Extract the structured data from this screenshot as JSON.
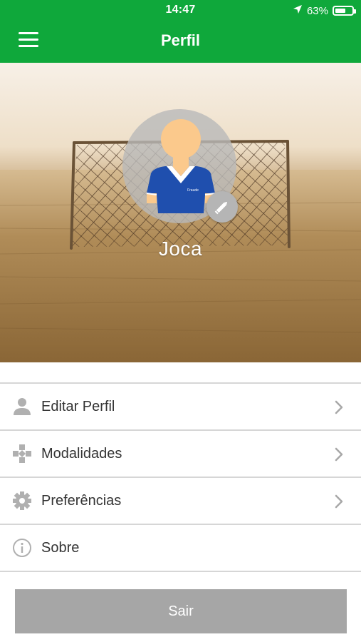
{
  "status_bar": {
    "time": "14:47",
    "battery_text": "63%",
    "battery_level": 0.63,
    "icons": [
      "location-arrow-icon",
      "battery-icon"
    ]
  },
  "app_bar": {
    "title": "Perfil",
    "menu_icon": "hamburger-menu-icon"
  },
  "profile": {
    "name": "Joca",
    "avatar_icon": "player-avatar-icon",
    "edit_icon": "pencil-icon",
    "jersey_text": "Fraude"
  },
  "menu": {
    "items": [
      {
        "label": "Editar Perfil",
        "icon": "user-icon",
        "has_chevron": true
      },
      {
        "label": "Modalidades",
        "icon": "gamepad-icon",
        "has_chevron": true
      },
      {
        "label": "Preferências",
        "icon": "gear-icon",
        "has_chevron": true
      },
      {
        "label": "Sobre",
        "icon": "info-icon",
        "has_chevron": false
      }
    ]
  },
  "logout": {
    "label": "Sair"
  },
  "colors": {
    "primary_green": "#0fa83b",
    "logout_gray": "#a6a6a6",
    "icon_gray": "#b0b0b0",
    "divider": "#d6d6d6"
  }
}
